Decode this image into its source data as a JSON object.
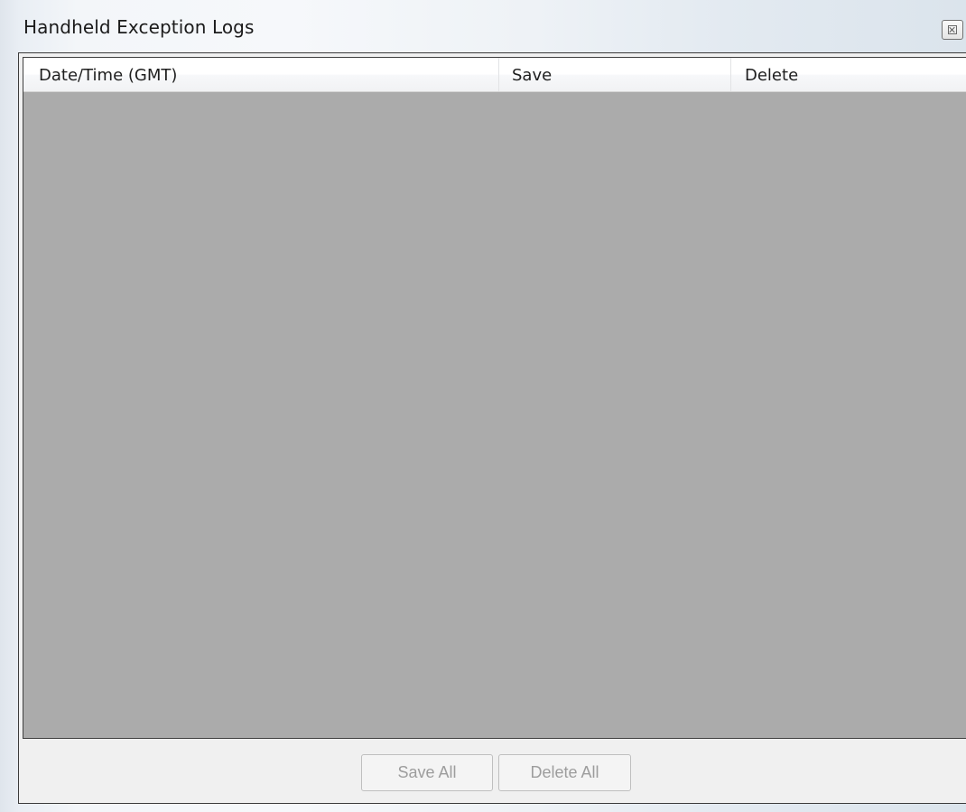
{
  "window": {
    "title": "Handheld Exception Logs",
    "close_glyph": "close-icon"
  },
  "grid": {
    "columns": [
      {
        "label": "Date/Time (GMT)"
      },
      {
        "label": "Save"
      },
      {
        "label": "Delete"
      }
    ],
    "rows": []
  },
  "footer": {
    "save_all_label": "Save All",
    "delete_all_label": "Delete All"
  },
  "colors": {
    "grid_background": "#ababab",
    "panel_background": "#f0f0f0",
    "disabled_text": "#9d9d9d"
  }
}
